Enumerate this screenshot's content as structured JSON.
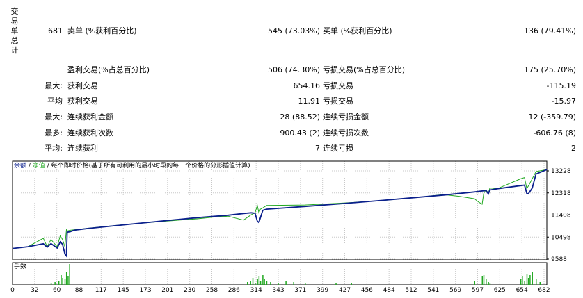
{
  "side_label": [
    "交",
    "易",
    "单",
    "总",
    "计"
  ],
  "stats": {
    "row1": {
      "total_count": "681",
      "short_label": "卖单 (%获利百分比)",
      "short_value": "545 (73.03%)",
      "long_label": "买单 (%获利百分比)",
      "long_value": "136 (79.41%)"
    },
    "row2": {
      "profit_label": "盈利交易(%占总百分比)",
      "profit_value": "506 (74.30%)",
      "loss_label": "亏损交易(%占总百分比)",
      "loss_value": "175 (25.70%)"
    },
    "row3": {
      "prefix": "最大:",
      "profit_label": "获利交易",
      "profit_value": "654.16",
      "loss_label": "亏损交易",
      "loss_value": "-115.19"
    },
    "row4": {
      "prefix": "平均",
      "profit_label": "获利交易",
      "profit_value": "11.91",
      "loss_label": "亏损交易",
      "loss_value": "-15.97"
    },
    "row5": {
      "prefix": "最大:",
      "profit_label": "连续获利金额",
      "profit_value": "28 (88.52)",
      "loss_label": "连续亏损金额",
      "loss_value": "12 (-359.79)"
    },
    "row6": {
      "prefix": "最多:",
      "profit_label": "连续获利次数",
      "profit_value": "900.43 (2)",
      "loss_label": "连续亏损次数",
      "loss_value": "-606.76 (8)"
    },
    "row7": {
      "prefix": "平均:",
      "profit_label": "连续获利",
      "profit_value": "7",
      "loss_label": "连续亏损",
      "loss_value": "2"
    }
  },
  "chart": {
    "legend_balance": "余额",
    "legend_sep1": " / ",
    "legend_equity": "净值",
    "legend_sep2": " / ",
    "legend_desc": "每个即时价格(基于所有可利用的最小时段的每一个价格的分形插值计算)",
    "volume_label": "手数",
    "colors": {
      "balance": "#0a1f8c",
      "equity": "#21a821",
      "volume": "#21a821",
      "grid": "#c8c8c8"
    }
  },
  "chart_data": {
    "type": "line",
    "y_ticks": [
      "13228",
      "12318",
      "11408",
      "10498",
      "9588"
    ],
    "x_ticks": [
      "0",
      "32",
      "60",
      "88",
      "117",
      "145",
      "173",
      "201",
      "230",
      "258",
      "286",
      "314",
      "343",
      "371",
      "399",
      "427",
      "456",
      "484",
      "512",
      "541",
      "569",
      "597",
      "625",
      "654",
      "682"
    ],
    "ylim": [
      9588,
      13228
    ],
    "xlim": [
      0,
      694
    ],
    "series": [
      {
        "key": "balance",
        "x": [
          0,
          20,
          40,
          45,
          50,
          58,
          62,
          65,
          68,
          70,
          71,
          75,
          80,
          100,
          150,
          200,
          240,
          260,
          280,
          300,
          310,
          315,
          318,
          320,
          325,
          330,
          380,
          430,
          480,
          520,
          560,
          600,
          615,
          618,
          620,
          630,
          660,
          665,
          668,
          670,
          675,
          680,
          694
        ],
        "y": [
          10030,
          10100,
          10220,
          10080,
          10230,
          10050,
          10300,
          10200,
          9800,
          9720,
          10700,
          10720,
          10780,
          10860,
          11020,
          11180,
          11300,
          11350,
          11400,
          11470,
          11500,
          11480,
          11150,
          11100,
          11600,
          11650,
          11760,
          11880,
          12010,
          12120,
          12230,
          12360,
          12420,
          12280,
          12440,
          12490,
          12620,
          12640,
          12300,
          12280,
          12520,
          13100,
          13280
        ]
      },
      {
        "key": "equity",
        "x": [
          0,
          20,
          40,
          45,
          50,
          58,
          62,
          65,
          68,
          70,
          71,
          75,
          80,
          100,
          150,
          200,
          240,
          260,
          280,
          300,
          310,
          315,
          318,
          320,
          322,
          325,
          330,
          380,
          430,
          480,
          520,
          560,
          580,
          600,
          605,
          610,
          612,
          615,
          618,
          620,
          630,
          660,
          665,
          668,
          670,
          675,
          680,
          694
        ],
        "y": [
          10030,
          10100,
          10450,
          10100,
          10400,
          10100,
          10550,
          10400,
          10100,
          10800,
          10750,
          10780,
          10800,
          10870,
          11030,
          11160,
          11250,
          11320,
          11360,
          11200,
          11420,
          11500,
          11800,
          11500,
          11650,
          11700,
          11800,
          11820,
          11900,
          12000,
          12120,
          12250,
          12180,
          12080,
          11950,
          11850,
          12300,
          12450,
          12300,
          12520,
          12500,
          12900,
          12950,
          12500,
          12600,
          12900,
          13200,
          13280
        ]
      }
    ],
    "volume": {
      "x": [
        50,
        55,
        60,
        63,
        65,
        68,
        70,
        72,
        74,
        305,
        309,
        312,
        315,
        318,
        320,
        322,
        325,
        327,
        330,
        335,
        345,
        355,
        365,
        380,
        420,
        440,
        600,
        610,
        612,
        615,
        618,
        620,
        660,
        662,
        665,
        668,
        670,
        672,
        675,
        680,
        685
      ],
      "v": [
        2,
        4,
        6,
        14,
        10,
        8,
        18,
        12,
        30,
        4,
        6,
        10,
        3,
        8,
        12,
        5,
        14,
        8,
        6,
        4,
        3,
        5,
        4,
        3,
        2,
        3,
        6,
        12,
        14,
        8,
        4,
        3,
        8,
        12,
        6,
        16,
        10,
        14,
        18,
        8,
        4
      ],
      "vmax": 30
    }
  }
}
